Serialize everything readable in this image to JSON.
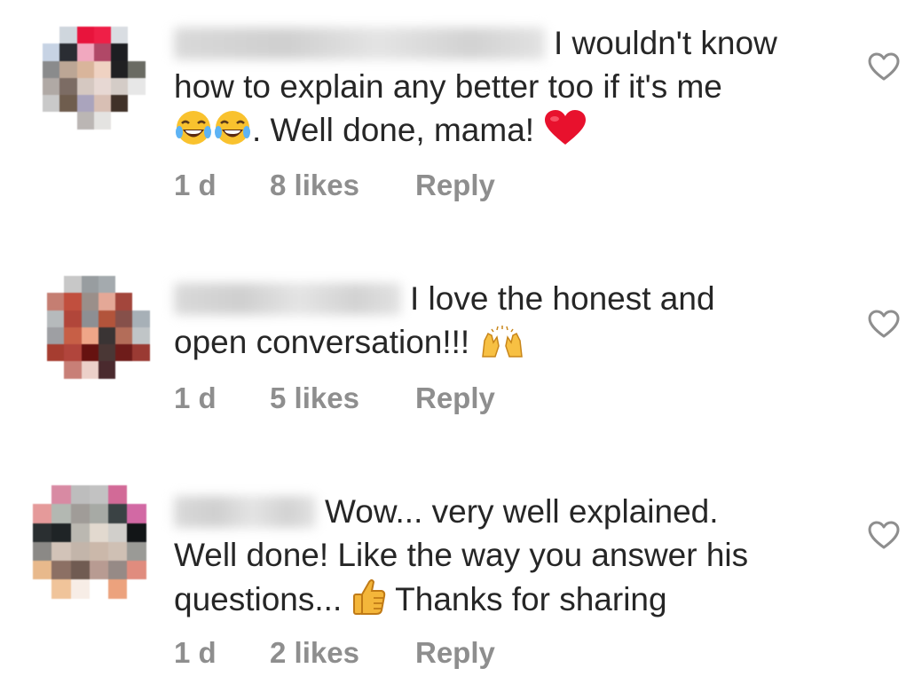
{
  "comments": [
    {
      "text_first": "I wouldn't know",
      "text_rest": "how to explain any better too if it's me",
      "text_end": ". Well done, mama!",
      "emojis": [
        "joy-emoji",
        "joy-emoji",
        "red-heart-emoji"
      ],
      "time": "1 d",
      "likes": "8 likes",
      "reply": "Reply"
    },
    {
      "text_first": "I love the honest and",
      "text_rest": "open conversation!!!",
      "emojis": [
        "raising-hands-emoji"
      ],
      "time": "1 d",
      "likes": "5 likes",
      "reply": "Reply"
    },
    {
      "text_first": "Wow... very well explained.",
      "text_rest": "Well done! Like the way you answer his",
      "text_end": "questions...",
      "text_after_emoji": "Thanks for sharing",
      "emojis": [
        "thumbs-up-emoji"
      ],
      "time": "1 d",
      "likes": "2 likes",
      "reply": "Reply"
    }
  ],
  "colors": {
    "text": "#262626",
    "meta": "#8e8e8e",
    "heart_outline": "#8e8e8e"
  }
}
